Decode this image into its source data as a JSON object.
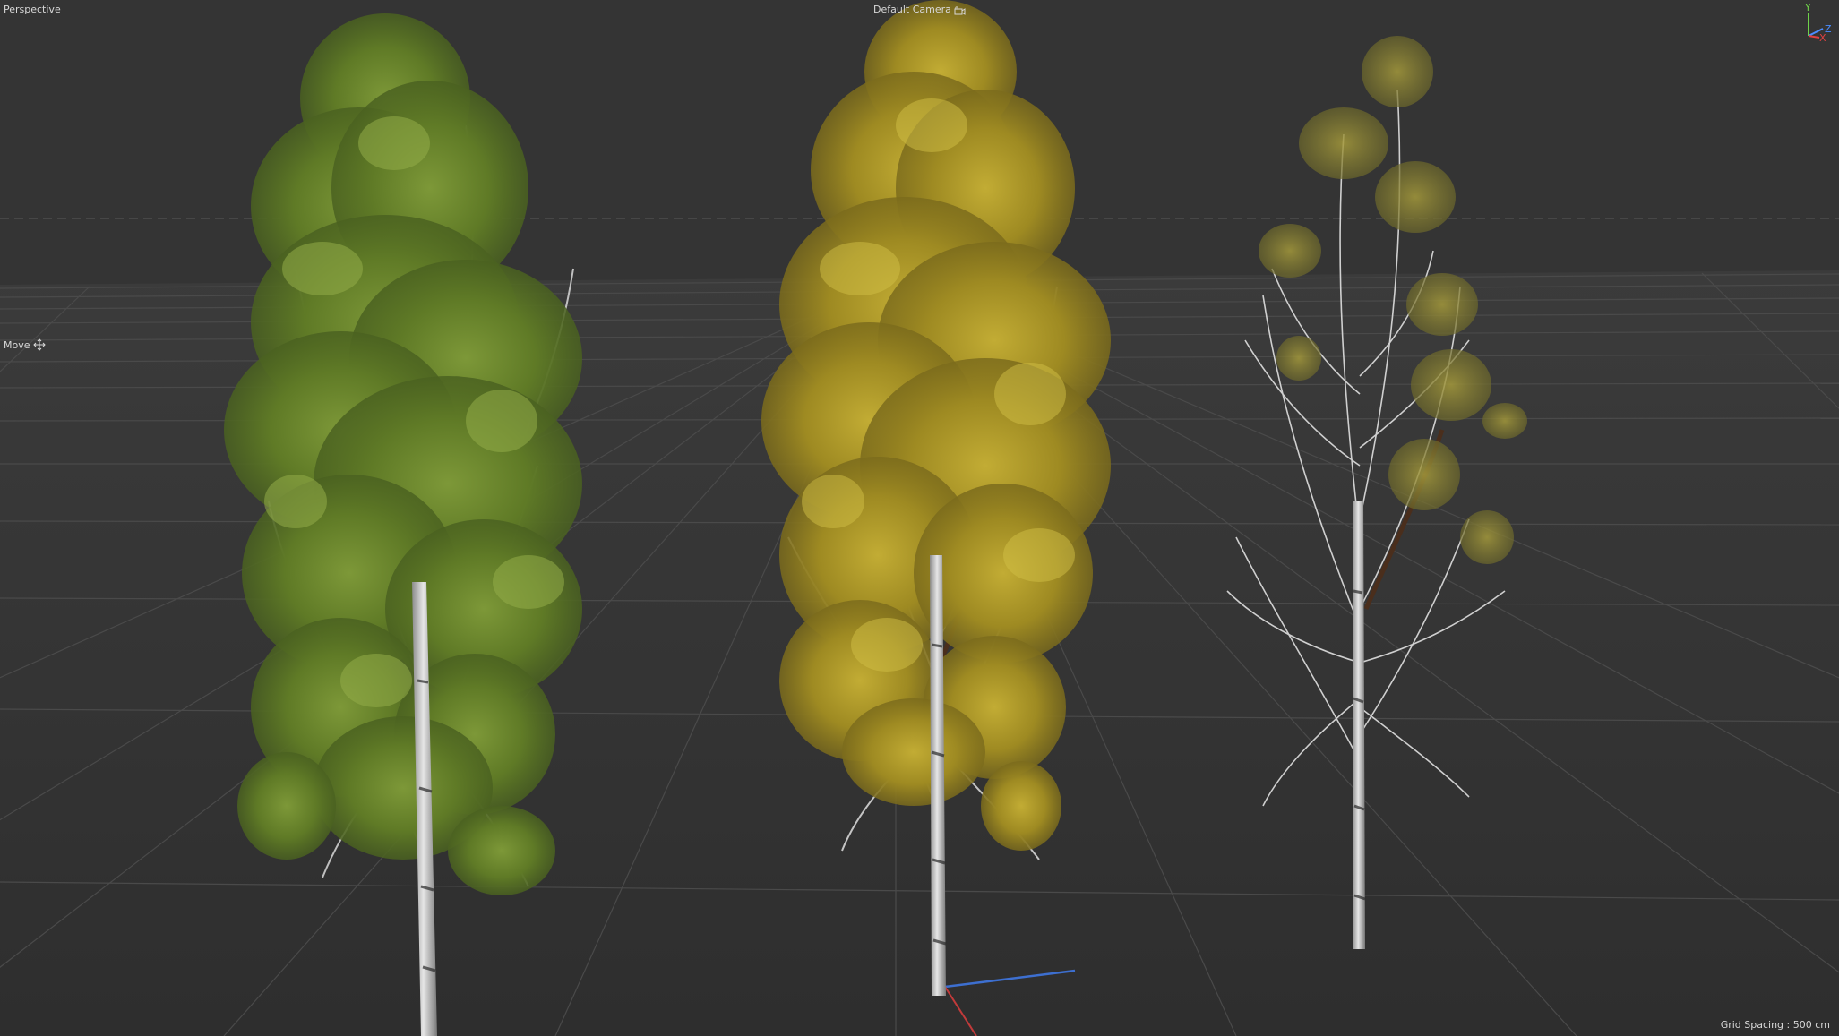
{
  "viewport": {
    "view_name": "Perspective",
    "camera_label": "Default Camera",
    "camera_icon": "camera-icon",
    "tool_label": "Move",
    "tool_icon": "move-icon",
    "grid_spacing": "Grid Spacing : 500 cm",
    "background_color": "#343434",
    "grid_color": "#4a4a4a"
  },
  "axis_gizmo": {
    "y_label": "Y",
    "z_label": "Z",
    "x_label": "X",
    "y_color": "#6fd34a",
    "z_color": "#4a8cff",
    "x_color": "#e04040"
  },
  "scene": {
    "objects": [
      {
        "name": "Birch tree",
        "foliage_color": "#6f8a2e"
      },
      {
        "name": "Birch tree",
        "foliage_color": "#a7962a"
      },
      {
        "name": "Birch tree",
        "foliage_color": "#8f8a3a"
      }
    ]
  }
}
